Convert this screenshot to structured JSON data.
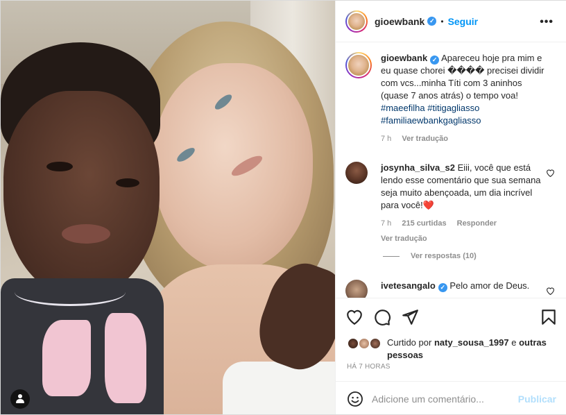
{
  "header": {
    "username": "gioewbank",
    "separator": "•",
    "follow_label": "Seguir",
    "more_icon": "more-horizontal-icon",
    "more_label": "•••"
  },
  "caption": {
    "username": "gioewbank",
    "text": "Apareceu hoje pra mim e eu quase chorei ����  precisei dividir com vcs...minha Títi com 3 aninhos (quase 7 anos atrás) o tempo voa!",
    "hashtags": [
      "#maeefilha",
      "#titigagliasso",
      "#familiaewbankgagliasso"
    ],
    "time": "7 h",
    "translate": "Ver tradução"
  },
  "comments": [
    {
      "username": "josynha_silva_s2",
      "text": "Eiii, você que está lendo esse comentário que sua semana seja muito abençoada, um dia incrível para você!",
      "emoji": "❤️",
      "time": "7 h",
      "likes": "215 curtidas",
      "reply": "Responder",
      "translate": "Ver tradução"
    },
    {
      "username": "ivetesangalo",
      "text": "Pelo amor de Deus."
    }
  ],
  "view_replies": "Ver respostas (10)",
  "actions": {
    "like_icon": "heart-icon",
    "comment_icon": "comment-icon",
    "share_icon": "send-icon",
    "save_icon": "bookmark-icon"
  },
  "likes": {
    "prefix": "Curtido por",
    "user": "naty_sousa_1997",
    "and": "e",
    "others": "outras pessoas"
  },
  "posted_ago": "HÁ 7 HORAS",
  "add_comment": {
    "placeholder": "Adicione um comentário...",
    "publish": "Publicar",
    "emoji_icon": "smiley-icon"
  },
  "colors": {
    "link_blue": "#0095f6",
    "hashtag": "#00376b",
    "muted": "#8e8e8e",
    "publish_disabled": "#b2dffc",
    "heart_red": "#ed4956"
  }
}
